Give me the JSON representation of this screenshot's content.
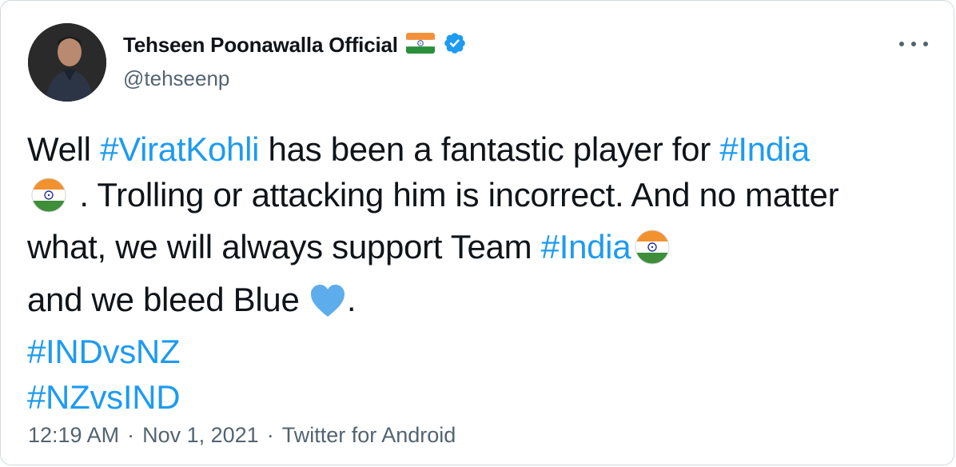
{
  "author": {
    "display_name": "Tehseen Poonawalla Official",
    "handle": "@tehseenp",
    "name_flag_icon": "india-flag-icon",
    "verified_icon": "verified-badge-icon"
  },
  "tweet": {
    "text_1": "Well ",
    "hashtag_1": "#ViratKohli",
    "text_2": " has been a fantastic player for ",
    "hashtag_2": "#India",
    "text_3": " . Trolling or attacking him is incorrect. And no matter what, we will always support Team ",
    "hashtag_3": "#India",
    "text_4": "and we bleed Blue ",
    "text_5": ".",
    "hashtag_4": "#INDvsNZ",
    "hashtag_5": "#NZvsIND"
  },
  "meta": {
    "time": "12:19 AM",
    "separator_1": "·",
    "date": "Nov 1, 2021",
    "separator_2": "·",
    "source": "Twitter for Android"
  },
  "colors": {
    "link": "#1d9bf0",
    "text": "#0f1419",
    "secondary": "#536471",
    "heart": "#5dadec"
  }
}
